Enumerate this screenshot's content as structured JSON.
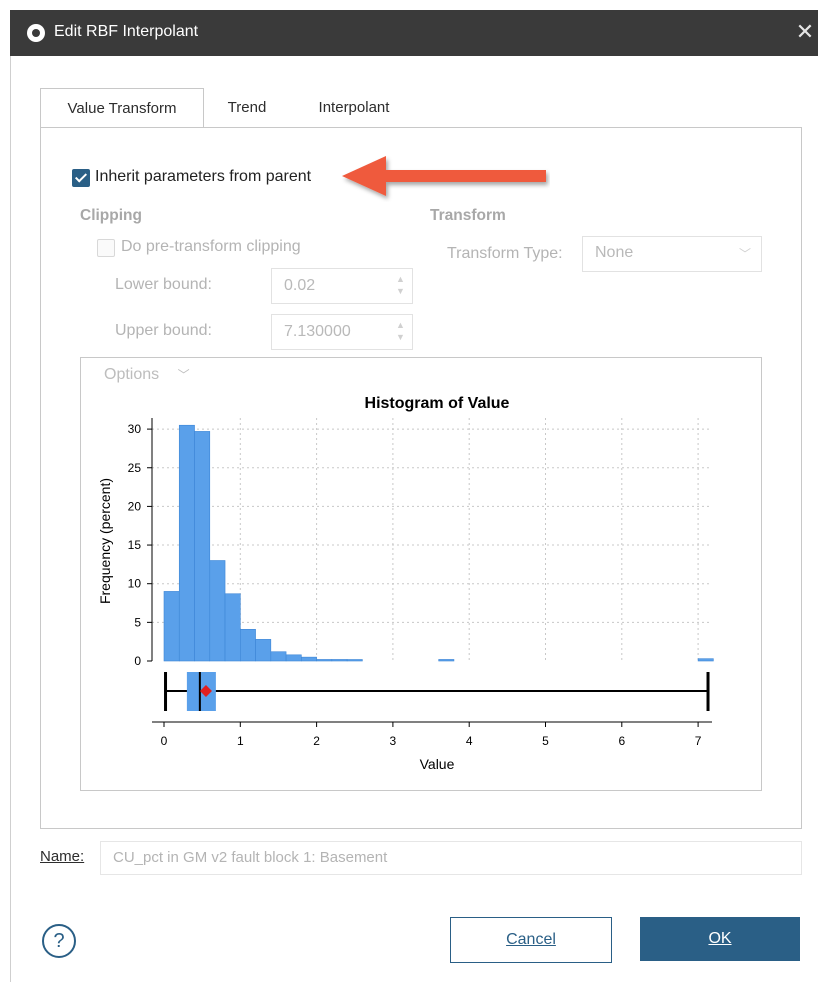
{
  "window": {
    "title": "Edit RBF Interpolant",
    "close_glyph": "✕"
  },
  "tabs": [
    {
      "label": "Value Transform",
      "active": true
    },
    {
      "label": "Trend",
      "active": false
    },
    {
      "label": "Interpolant",
      "active": false
    }
  ],
  "inherit": {
    "label": "Inherit parameters from parent",
    "checked": true
  },
  "clipping": {
    "heading": "Clipping",
    "checkbox_label": "Do pre-transform clipping",
    "lower_label": "Lower bound:",
    "lower_value": "0.02",
    "upper_label": "Upper bound:",
    "upper_value": "7.130000"
  },
  "transform": {
    "heading": "Transform",
    "type_label": "Transform Type:",
    "type_value": "None"
  },
  "options_label": "Options",
  "colors": {
    "accent": "#2a5f86",
    "bar": "#5aa0ea",
    "arrow": "#ef5a3c"
  },
  "chart_data": {
    "type": "bar",
    "title": "Histogram of Value",
    "xlabel": "Value",
    "ylabel": "Frequency (percent)",
    "xlim": [
      0,
      7.2
    ],
    "ylim": [
      0,
      31
    ],
    "x_ticks": [
      "0",
      "1",
      "2",
      "3",
      "4",
      "5",
      "6",
      "7"
    ],
    "y_ticks": [
      "0",
      "5",
      "10",
      "15",
      "20",
      "25",
      "30"
    ],
    "bin_width": 0.2,
    "bin_starts": [
      0.0,
      0.2,
      0.4,
      0.6,
      0.8,
      1.0,
      1.2,
      1.4,
      1.6,
      1.8,
      2.0,
      2.2,
      2.4,
      3.6,
      7.0
    ],
    "values": [
      9.0,
      30.5,
      29.7,
      13.0,
      8.7,
      4.1,
      2.8,
      1.2,
      0.8,
      0.5,
      0.2,
      0.2,
      0.1,
      0.2,
      0.3
    ],
    "boxplot": {
      "min": 0.02,
      "q1": 0.3,
      "median": 0.47,
      "mean": 0.55,
      "q3": 0.68,
      "max": 7.13
    },
    "grid": true
  },
  "name": {
    "label": "Name:",
    "value": "CU_pct in GM v2 fault block 1: Basement"
  },
  "help_glyph": "?",
  "buttons": {
    "cancel": "Cancel",
    "ok": "OK"
  }
}
